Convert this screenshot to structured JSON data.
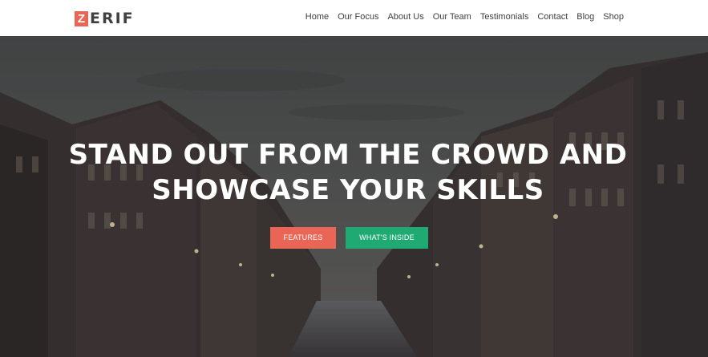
{
  "brand": {
    "logo_mark": "Z",
    "logo_rest": "ERIF",
    "accent_color": "#e96656"
  },
  "nav": {
    "items": [
      "Home",
      "Our Focus",
      "About Us",
      "Our Team",
      "Testimonials",
      "Contact",
      "Blog",
      "Shop"
    ]
  },
  "hero": {
    "headline_line1": "STAND OUT FROM THE CROWD AND",
    "headline_line2": "SHOWCASE YOUR SKILLS",
    "primary_button": "FEATURES",
    "primary_color": "#e96656",
    "secondary_button": "WHAT'S INSIDE",
    "secondary_color": "#20aa73"
  }
}
